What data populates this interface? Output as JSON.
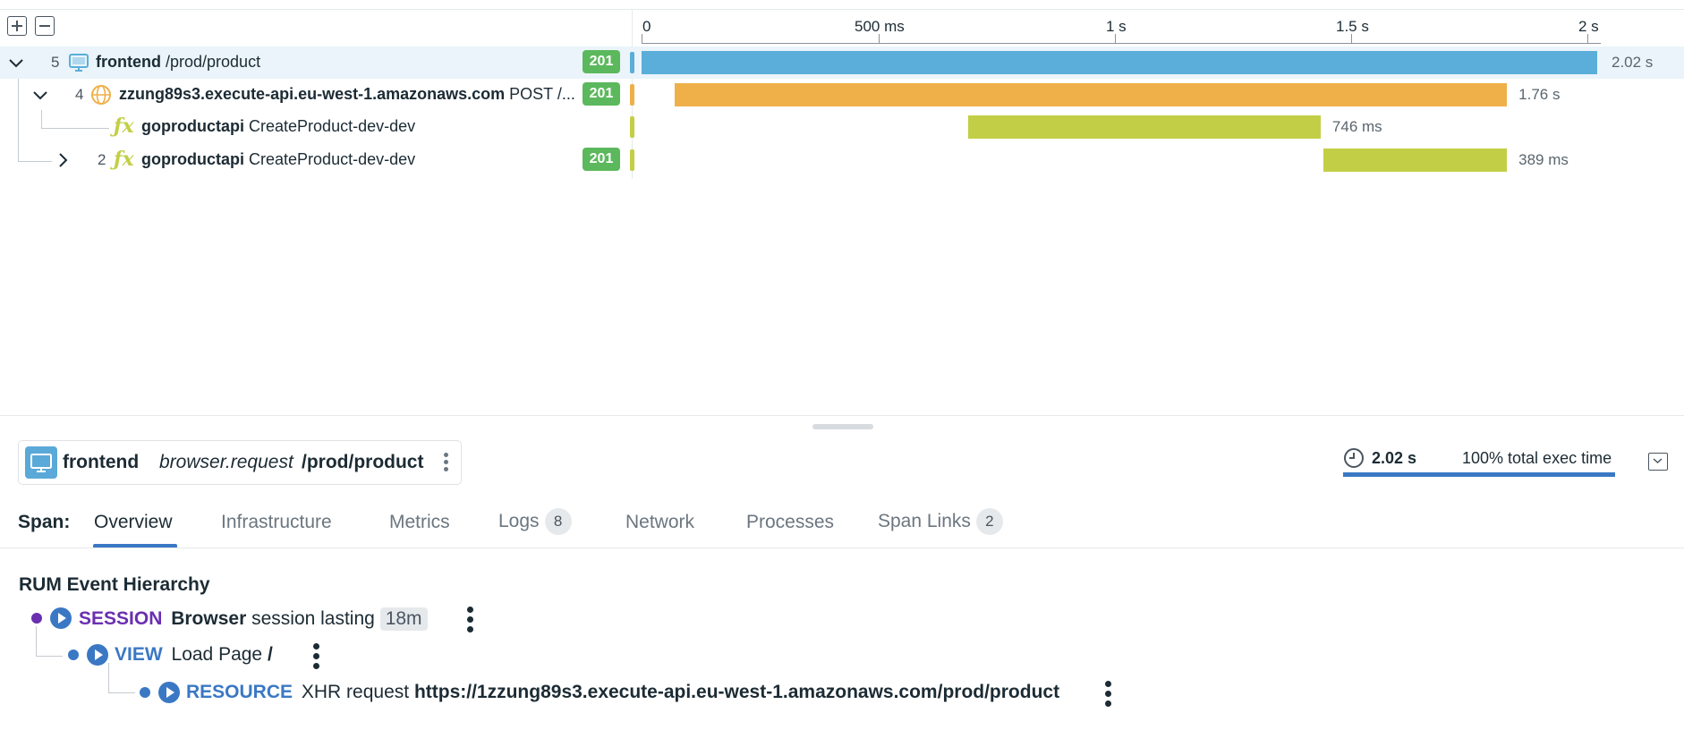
{
  "flame": {
    "axis_ticks": [
      "0",
      "500 ms",
      "1 s",
      "1.5 s",
      "2 s"
    ],
    "rows": [
      {
        "count": "5",
        "service": "frontend",
        "resource": "/prod/product",
        "status": "201",
        "duration": "2.02 s",
        "color": "#5aaed9",
        "start_s": 0.0,
        "end_s": 2.02,
        "icon": "monitor-icon",
        "expanded": true
      },
      {
        "count": "4",
        "service": "zzung89s3.execute-api.eu-west-1.amazonaws.com",
        "resource": "POST /...",
        "status": "201",
        "duration": "1.76 s",
        "color": "#efb04a",
        "start_s": 0.07,
        "end_s": 1.83,
        "icon": "globe-icon",
        "expanded": true
      },
      {
        "count": "",
        "service": "goproductapi",
        "resource": "CreateProduct-dev-dev",
        "status": "",
        "duration": "746 ms",
        "color": "#c2cf46",
        "start_s": 0.69,
        "end_s": 1.436,
        "icon": "function-icon",
        "expanded": null
      },
      {
        "count": "2",
        "service": "goproductapi",
        "resource": "CreateProduct-dev-dev",
        "status": "201",
        "duration": "389 ms",
        "color": "#c2cf46",
        "start_s": 1.441,
        "end_s": 1.83,
        "icon": "function-icon",
        "expanded": false
      }
    ]
  },
  "span_header": {
    "service": "frontend",
    "operation": "browser.request",
    "resource": "/prod/product",
    "duration": "2.02 s",
    "exec_time": "100% total exec time",
    "exec_fraction": 1.0
  },
  "tabs": {
    "label": "Span:",
    "items": [
      {
        "label": "Overview",
        "count": "",
        "active": true
      },
      {
        "label": "Infrastructure",
        "count": ""
      },
      {
        "label": "Metrics",
        "count": ""
      },
      {
        "label": "Logs",
        "count": "8"
      },
      {
        "label": "Network",
        "count": ""
      },
      {
        "label": "Processes",
        "count": ""
      },
      {
        "label": "Span Links",
        "count": "2"
      }
    ]
  },
  "rum": {
    "title": "RUM Event Hierarchy",
    "session": {
      "type": "SESSION",
      "bold": "Browser",
      "text": "session lasting",
      "pill": "18m",
      "color": "#6a2fb0"
    },
    "view": {
      "type": "VIEW",
      "text": "Load Page",
      "bold": "/",
      "color": "#3a78c4"
    },
    "resource": {
      "type": "RESOURCE",
      "text": "XHR request",
      "bold": "https://1zzung89s3.execute-api.eu-west-1.amazonaws.com/prod/product",
      "color": "#3a78c4"
    }
  }
}
